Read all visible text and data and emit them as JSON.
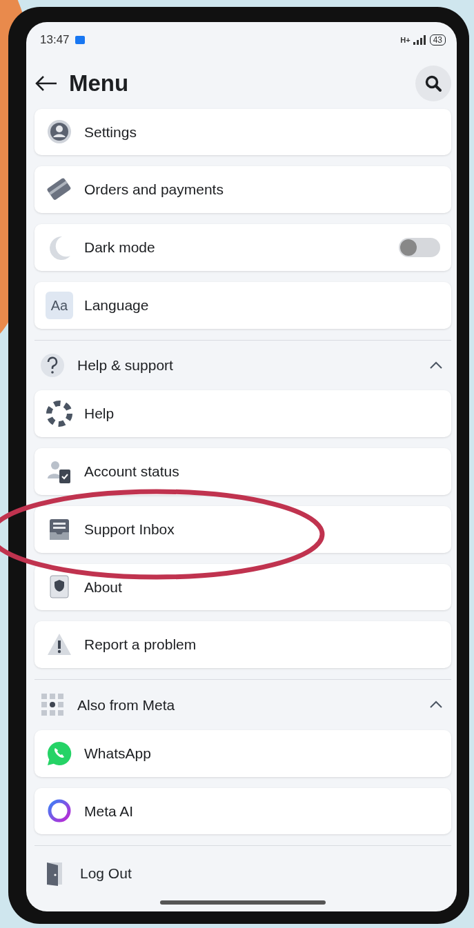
{
  "status_bar": {
    "time": "13:47",
    "network": "H+",
    "battery": "43"
  },
  "header": {
    "title": "Menu"
  },
  "items": [
    {
      "label": "Settings",
      "kind": "link"
    },
    {
      "label": "Orders and payments",
      "kind": "link"
    },
    {
      "label": "Dark mode",
      "kind": "toggle",
      "on": false
    },
    {
      "label": "Language",
      "kind": "link",
      "icon_text": "Aa"
    }
  ],
  "sections": [
    {
      "title": "Help & support",
      "expanded": true,
      "items": [
        {
          "label": "Help"
        },
        {
          "label": "Account status"
        },
        {
          "label": "Support Inbox"
        },
        {
          "label": "About"
        },
        {
          "label": "Report a problem"
        }
      ]
    },
    {
      "title": "Also from Meta",
      "expanded": true,
      "items": [
        {
          "label": "WhatsApp"
        },
        {
          "label": "Meta AI"
        }
      ]
    }
  ],
  "footer": {
    "label": "Log Out"
  }
}
